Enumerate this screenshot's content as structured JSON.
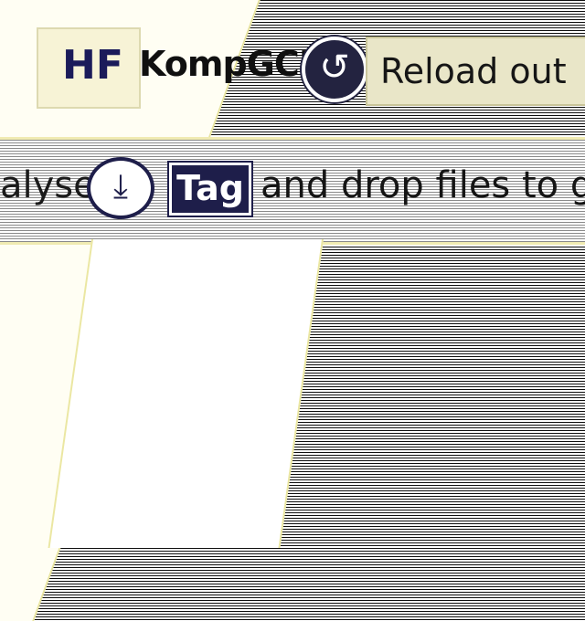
{
  "app": {
    "title": "KompGC's",
    "icon_name": "hf-icon",
    "icon_text": "HF"
  },
  "toolbar": {
    "badge_icon": "refresh-icon",
    "badge_text": "↺",
    "reload_label": "Reload out"
  },
  "filter": {
    "prefix_text": "alyse",
    "collapse_icon": "download-icon",
    "collapse_text": "⤓",
    "tag_label": "Tag",
    "drop_hint": "and drop files to g"
  },
  "colors": {
    "accent": "#1e1e4a",
    "panel": "#fffef3",
    "border": "#ebe7a2"
  }
}
